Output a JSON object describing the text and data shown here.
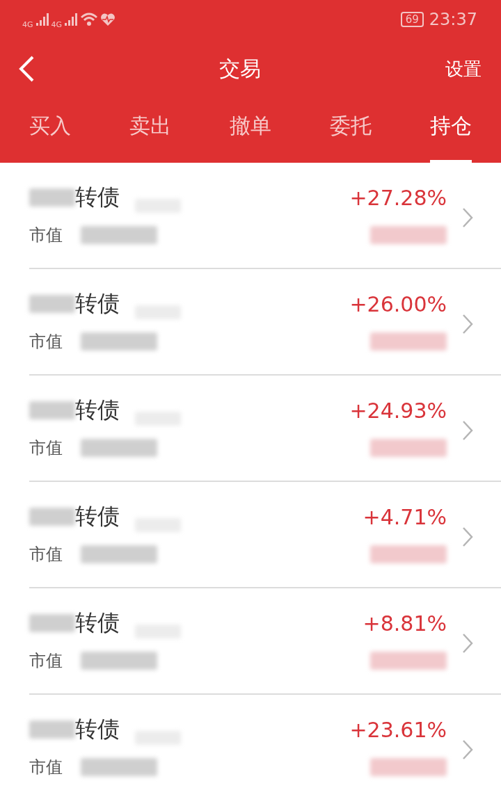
{
  "status_bar": {
    "signal_labels": [
      "4G",
      "4G"
    ],
    "battery": "69",
    "time": "23:37"
  },
  "header": {
    "title": "交易",
    "action": "设置"
  },
  "tabs": [
    {
      "label": "买入",
      "selected": false
    },
    {
      "label": "卖出",
      "selected": false
    },
    {
      "label": "撤单",
      "selected": false
    },
    {
      "label": "委托",
      "selected": false
    },
    {
      "label": "持仓",
      "selected": true
    }
  ],
  "holdings": [
    {
      "name": "转债",
      "value_label": "市值",
      "change": "+27.28%"
    },
    {
      "name": "转债",
      "value_label": "市值",
      "change": "+26.00%"
    },
    {
      "name": "转债",
      "value_label": "市值",
      "change": "+24.93%"
    },
    {
      "name": "转债",
      "value_label": "市值",
      "change": "+4.71%"
    },
    {
      "name": "转债",
      "value_label": "市值",
      "change": "+8.81%"
    },
    {
      "name": "转债",
      "value_label": "市值",
      "change": "+23.61%"
    }
  ]
}
